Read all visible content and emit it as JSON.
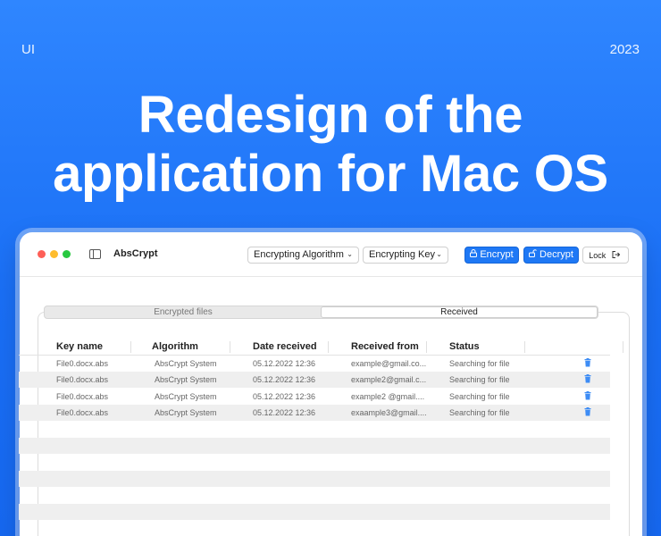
{
  "corner_left": "UI",
  "corner_right": "2023",
  "headline": {
    "line1": "Redesign of the",
    "line2": "application for Mac OS"
  },
  "window": {
    "app_title": "AbsCrypt",
    "algorithm_select": "Encrypting Algorithm",
    "key_select": "Encrypting Key",
    "encrypt_label": "Encrypt",
    "decrypt_label": "Decrypt",
    "lock_label": "Lock",
    "icons": {
      "encrypt": "lock-icon",
      "decrypt": "unlock-icon",
      "lock": "logout-icon",
      "sidebar": "sidebar-toggle-icon",
      "delete": "trash-icon"
    }
  },
  "tabs": {
    "encrypted": "Encrypted files",
    "received": "Received",
    "active": "received"
  },
  "table": {
    "headers": [
      "Key name",
      "Algorithm",
      "Date received",
      "Received from",
      "Status"
    ],
    "rows": [
      [
        "File0.docx.abs",
        "AbsCrypt System",
        "05.12.2022 12:36",
        "example@gmail.co...",
        "Searching for file"
      ],
      [
        "File0.docx.abs",
        "AbsCrypt System",
        "05.12.2022 12:36",
        "example2@gmail.c...",
        "Searching for file"
      ],
      [
        "File0.docx.abs",
        "AbsCrypt System",
        "05.12.2022 12:36",
        "example2 @gmail....",
        "Searching for file"
      ],
      [
        "File0.docx.abs",
        "AbsCrypt System",
        "05.12.2022 12:36",
        "exaample3@gmail....",
        "Searching for file"
      ]
    ]
  },
  "colors": {
    "background_top": "#2f86ff",
    "background_bottom": "#1668f0",
    "accent_blue": "#1e78f5",
    "trash_icon": "#3d8cf5"
  }
}
